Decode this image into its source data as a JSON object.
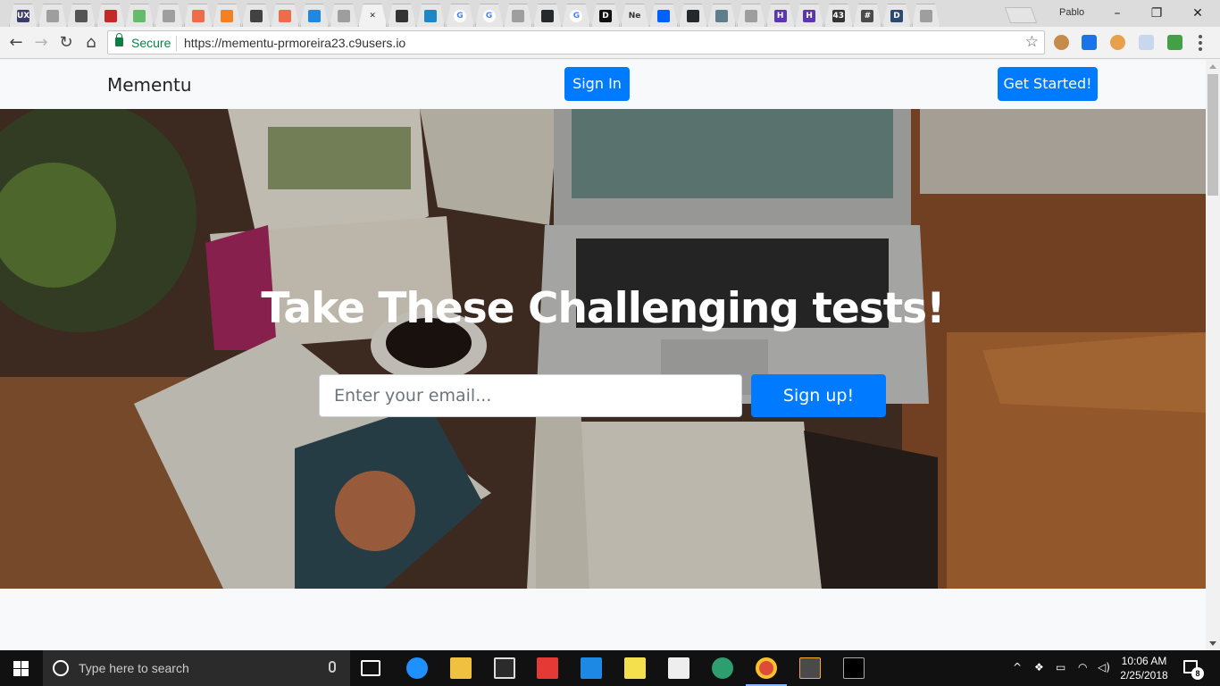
{
  "browser": {
    "tabs": [
      {
        "icon": "uxs-icon",
        "color": "#3b3b6b",
        "glyph": "UX"
      },
      {
        "icon": "document-icon",
        "color": "#9e9e9e",
        "glyph": ""
      },
      {
        "icon": "penguin-icon",
        "color": "#555555",
        "glyph": ""
      },
      {
        "icon": "red-app-icon",
        "color": "#c62828",
        "glyph": ""
      },
      {
        "icon": "leaf-icon",
        "color": "#66bb6a",
        "glyph": ""
      },
      {
        "icon": "document-icon",
        "color": "#9e9e9e",
        "glyph": ""
      },
      {
        "icon": "stripes-icon",
        "color": "#ef6c4a",
        "glyph": ""
      },
      {
        "icon": "stackoverflow-icon",
        "color": "#f48024",
        "glyph": ""
      },
      {
        "icon": "keyboard-icon",
        "color": "#424242",
        "glyph": ""
      },
      {
        "icon": "stripes-icon",
        "color": "#ef6c4a",
        "glyph": ""
      },
      {
        "icon": "screen-icon",
        "color": "#1e88e5",
        "glyph": ""
      },
      {
        "icon": "document-icon",
        "color": "#9e9e9e",
        "glyph": ""
      },
      {
        "icon": "close-tab-icon",
        "color": "#f2f2f2",
        "glyph": "✕"
      },
      {
        "icon": "chart-icon",
        "color": "#333333",
        "glyph": ""
      },
      {
        "icon": "cloud9-icon",
        "color": "#1c88c7",
        "glyph": ""
      },
      {
        "icon": "google-icon",
        "color": "#4285f4",
        "glyph": "G"
      },
      {
        "icon": "google-icon",
        "color": "#4285f4",
        "glyph": "G"
      },
      {
        "icon": "document-icon",
        "color": "#9e9e9e",
        "glyph": ""
      },
      {
        "icon": "github-icon",
        "color": "#24292e",
        "glyph": ""
      },
      {
        "icon": "google-icon",
        "color": "#4285f4",
        "glyph": "G"
      },
      {
        "icon": "d-app-icon",
        "color": "#111111",
        "glyph": "D"
      },
      {
        "icon": "netflix-text-icon",
        "color": "#e6e6e6",
        "glyph": "Ne"
      },
      {
        "icon": "dropbox-icon",
        "color": "#0061ff",
        "glyph": ""
      },
      {
        "icon": "github-icon",
        "color": "#24292e",
        "glyph": ""
      },
      {
        "icon": "link-icon",
        "color": "#607d8b",
        "glyph": ""
      },
      {
        "icon": "document-icon",
        "color": "#9e9e9e",
        "glyph": ""
      },
      {
        "icon": "h-app-icon",
        "color": "#5e35b1",
        "glyph": "H"
      },
      {
        "icon": "h-app-icon",
        "color": "#5e35b1",
        "glyph": "H"
      },
      {
        "icon": "badge-43-icon",
        "color": "#333333",
        "glyph": "43"
      },
      {
        "icon": "slack-icon",
        "color": "#4a4a4a",
        "glyph": "#"
      },
      {
        "icon": "d-circle-icon",
        "color": "#2c4a6e",
        "glyph": "D"
      },
      {
        "icon": "document-icon",
        "color": "#9e9e9e",
        "glyph": ""
      }
    ],
    "profile_name": "Pablo",
    "secure_label": "Secure",
    "url": "https://mementu-prmoreira23.c9users.io"
  },
  "page": {
    "brand": "Mementu",
    "sign_in_label": "Sign In",
    "get_started_label": "Get Started!",
    "hero_title": "Take These Challenging tests!",
    "email_placeholder": "Enter your email...",
    "sign_up_label": "Sign up!",
    "primary_color": "#007bff"
  },
  "taskbar": {
    "search_placeholder": "Type here to search",
    "time": "10:06 AM",
    "date": "2/25/2018",
    "notification_count": "8"
  }
}
